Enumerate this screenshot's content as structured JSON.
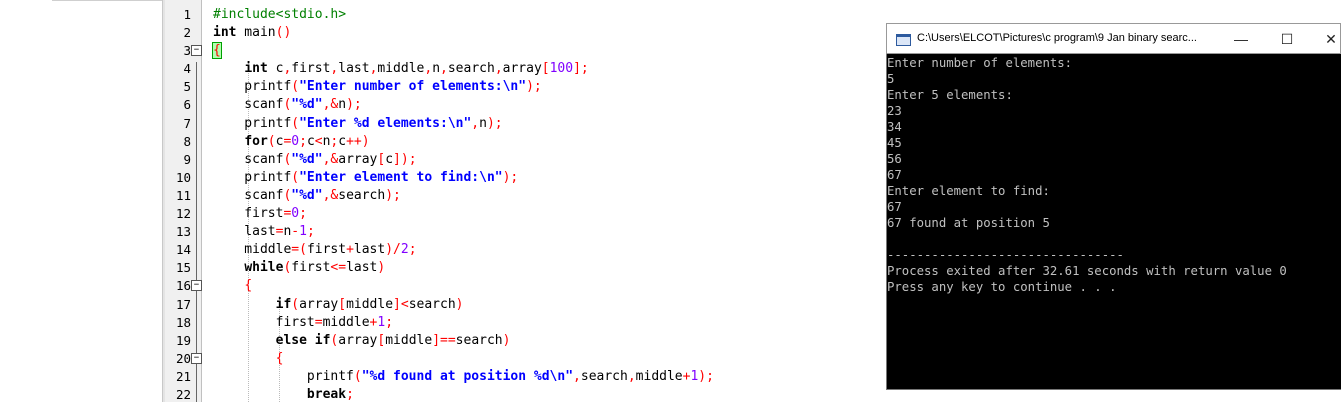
{
  "editor": {
    "line_numbers": [
      "1",
      "2",
      "3",
      "4",
      "5",
      "6",
      "7",
      "8",
      "9",
      "10",
      "11",
      "12",
      "13",
      "14",
      "15",
      "16",
      "17",
      "18",
      "19",
      "20",
      "21",
      "22"
    ]
  },
  "console": {
    "title": "C:\\Users\\ELCOT\\Pictures\\c program\\9 Jan binary searc...",
    "minimize_glyph": "—",
    "maximize_glyph": "☐",
    "close_glyph": "✕",
    "lines": [
      "Enter number of elements:",
      "5",
      "Enter 5 elements:",
      "23",
      "34",
      "45",
      "56",
      "67",
      "Enter element to find:",
      "67",
      "67 found at position 5",
      "",
      "--------------------------------",
      "Process exited after 32.61 seconds with return value 0",
      "Press any key to continue . . ."
    ]
  }
}
